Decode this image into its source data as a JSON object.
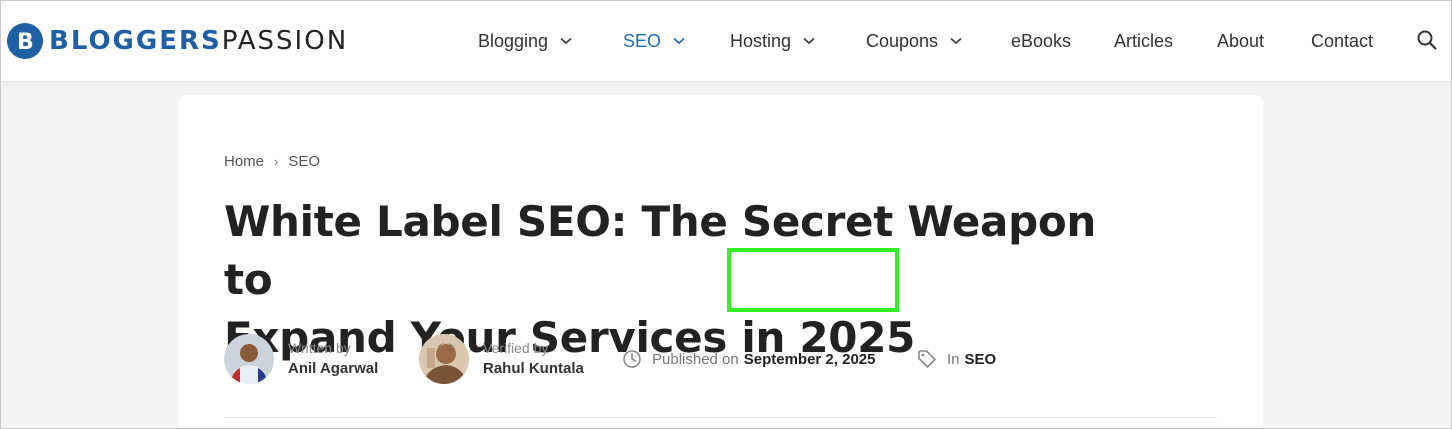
{
  "header": {
    "logo_part1": "BLOGGERS",
    "logo_part2": "PASSION",
    "logo_letter": "B",
    "brand_color": "#1f5fa3",
    "nav": [
      {
        "label": "Blogging",
        "has_dropdown": true
      },
      {
        "label": "SEO",
        "has_dropdown": true,
        "active": true
      },
      {
        "label": "Hosting",
        "has_dropdown": true
      },
      {
        "label": "Coupons",
        "has_dropdown": true
      },
      {
        "label": "eBooks"
      },
      {
        "label": "Articles"
      },
      {
        "label": "About"
      },
      {
        "label": "Contact"
      }
    ],
    "search_icon": "search-icon"
  },
  "article": {
    "breadcrumb": {
      "home": "Home",
      "current": "SEO"
    },
    "title_line1": "White Label SEO: The Secret Weapon to",
    "title_line2_prefix": "Expand Your Services in",
    "title_year": "2025",
    "highlight_color": "#33ee22",
    "author": {
      "prefix": "Written by",
      "name": "Anil Agarwal"
    },
    "verifier": {
      "prefix": "Verified by",
      "name": "Rahul Kuntala"
    },
    "published": {
      "prefix": "Published on",
      "date": "September 2, 2025"
    },
    "category": {
      "prefix": "In",
      "name": "SEO"
    }
  }
}
